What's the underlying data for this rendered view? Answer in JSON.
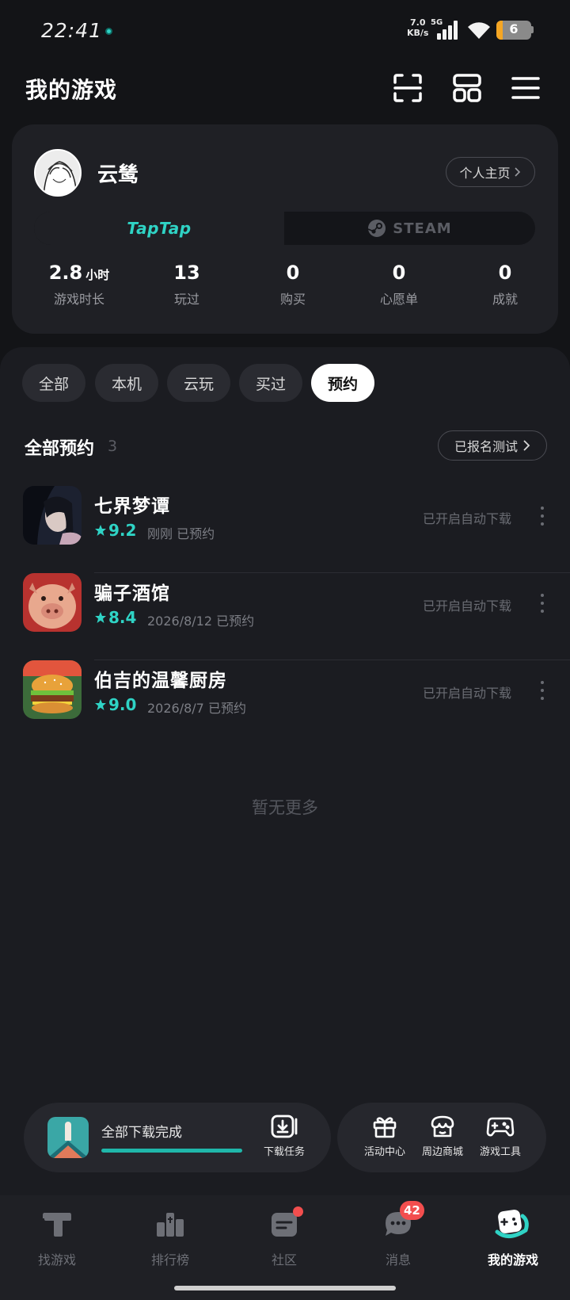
{
  "status_bar": {
    "time": "22:41",
    "net_speed_value": "7.0",
    "net_speed_unit": "KB/s",
    "net_type": "5G",
    "battery": "6"
  },
  "header": {
    "title": "我的游戏"
  },
  "profile": {
    "username": "云鸶",
    "homepage_label": "个人主页",
    "platforms": {
      "taptap": "TapTap",
      "steam": "STEAM"
    },
    "stats": [
      {
        "value": "2.8",
        "unit": "小时",
        "label": "游戏时长"
      },
      {
        "value": "13",
        "unit": "",
        "label": "玩过"
      },
      {
        "value": "0",
        "unit": "",
        "label": "购买"
      },
      {
        "value": "0",
        "unit": "",
        "label": "心愿单"
      },
      {
        "value": "0",
        "unit": "",
        "label": "成就"
      }
    ]
  },
  "filters": [
    "全部",
    "本机",
    "云玩",
    "买过",
    "预约"
  ],
  "active_filter": "预约",
  "section": {
    "title": "全部预约",
    "count": "3",
    "tested_label": "已报名测试"
  },
  "games": [
    {
      "name": "七界梦谭",
      "rating": "9.2",
      "date": "刚刚 已预约",
      "status": "已开启自动下载"
    },
    {
      "name": "骗子酒馆",
      "rating": "8.4",
      "date": "2026/8/12 已预约",
      "status": "已开启自动下载"
    },
    {
      "name": "伯吉的温馨厨房",
      "rating": "9.0",
      "date": "2026/8/7 已预约",
      "status": "已开启自动下载"
    }
  ],
  "no_more": "暂无更多",
  "download": {
    "status": "全部下载完成",
    "progress": 1.0,
    "task_label": "下载任务"
  },
  "tools": [
    {
      "label": "活动中心"
    },
    {
      "label": "周边商城"
    },
    {
      "label": "游戏工具"
    }
  ],
  "nav": [
    {
      "label": "找游戏"
    },
    {
      "label": "排行榜"
    },
    {
      "label": "社区"
    },
    {
      "label": "消息",
      "badge": "42"
    },
    {
      "label": "我的游戏"
    }
  ],
  "colors": {
    "accent": "#2fd3c5",
    "background": "#131417",
    "card": "#1f2025",
    "badge": "#f24e4e"
  }
}
